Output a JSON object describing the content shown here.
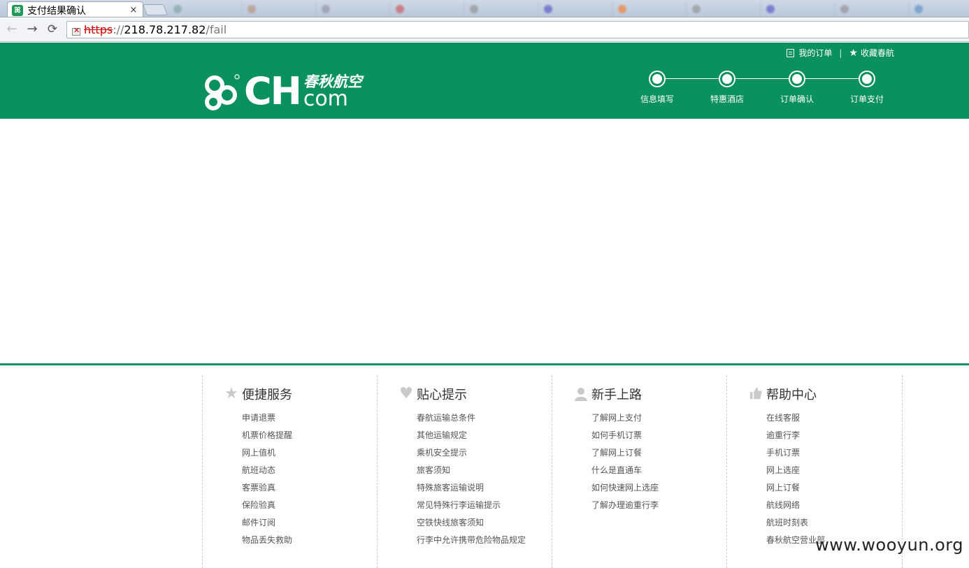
{
  "browser": {
    "active_tab": {
      "title": "支付结果确认",
      "close": "×"
    },
    "background_tabs": [
      "",
      "",
      "",
      "",
      "",
      "",
      "",
      "",
      "",
      "",
      ""
    ],
    "url": {
      "scheme": "https",
      "sep": "://",
      "host": "218.78.217.82",
      "path": "/fail"
    }
  },
  "header": {
    "links": {
      "orders": "我的订单",
      "divider": "|",
      "favorite": "收藏春航"
    },
    "logo": {
      "mark": "S",
      "letters": "CH",
      "cn": "春秋航空",
      "com": "com"
    },
    "steps": [
      "信息填写",
      "特惠酒店",
      "订单确认",
      "订单支付"
    ]
  },
  "footer": {
    "columns": [
      {
        "title": "便捷服务",
        "icon": "star-icon",
        "items": [
          "申请退票",
          "机票价格提醒",
          "网上值机",
          "航班动态",
          "客票验真",
          "保险验真",
          "邮件订阅",
          "物品丢失救助"
        ]
      },
      {
        "title": "贴心提示",
        "icon": "heart-icon",
        "items": [
          "春航运输总条件",
          "其他运输规定",
          "乘机安全提示",
          "旅客须知",
          "特殊旅客运输说明",
          "常见特殊行李运输提示",
          "空铁快线旅客须知",
          "行李中允许携带危险物品规定"
        ]
      },
      {
        "title": "新手上路",
        "icon": "person-icon",
        "items": [
          "了解网上支付",
          "如何手机订票",
          "了解网上订餐",
          "什么是直通车",
          "如何快速网上选座",
          "了解办理逾重行李"
        ]
      },
      {
        "title": "帮助中心",
        "icon": "thumbs-up-icon",
        "items": [
          "在线客服",
          "逾重行李",
          "手机订票",
          "网上选座",
          "网上订餐",
          "航线网络",
          "航班时刻表",
          "春秋航空营业部"
        ]
      }
    ]
  },
  "watermark": "www.wooyun.org",
  "colors": {
    "brand_green": "#0a915e",
    "footer_icon": "#c9c9c9"
  }
}
